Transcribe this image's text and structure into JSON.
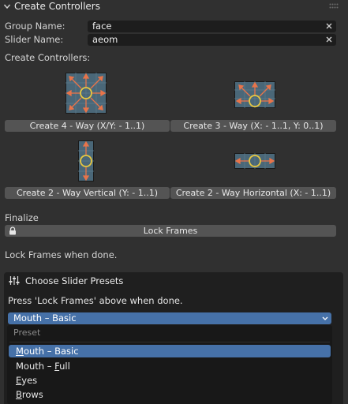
{
  "header": {
    "title": "Create Controllers"
  },
  "group_field": {
    "label": "Group Name:",
    "value": "face"
  },
  "slider_field": {
    "label": "Slider Name:",
    "value": "aeom"
  },
  "create_section_label": "Create Controllers:",
  "buttons": {
    "four_way": "Create 4 - Way (X/Y: - 1..1)",
    "three_way": "Create 3 - Way (X: - 1..1, Y: 0..1)",
    "two_way_vertical": "Create 2 - Way Vertical (Y: - 1..1)",
    "two_way_horizontal": "Create 2 - Way Horizontal (X: - 1..1)"
  },
  "finalize": {
    "label": "Finalize",
    "lock_button": "Lock Frames",
    "note": "Lock Frames when done."
  },
  "presets_panel": {
    "title": "Choose Slider Presets",
    "note": "Press 'Lock Frames' above when done.",
    "selected": "Mouth – Basic",
    "menu_header": "Preset",
    "options": [
      {
        "first": "M",
        "rest": "outh – Basic"
      },
      {
        "first": "",
        "rest": "Mouth – ",
        "under": "F",
        "tail": "ull"
      },
      {
        "first": "E",
        "rest": "yes"
      },
      {
        "first": "B",
        "rest": "rows"
      }
    ]
  },
  "colors": {
    "accent": "#4671a8",
    "arrow": "#e8744a",
    "ring": "#e8c840",
    "pad": "#4a6778"
  }
}
